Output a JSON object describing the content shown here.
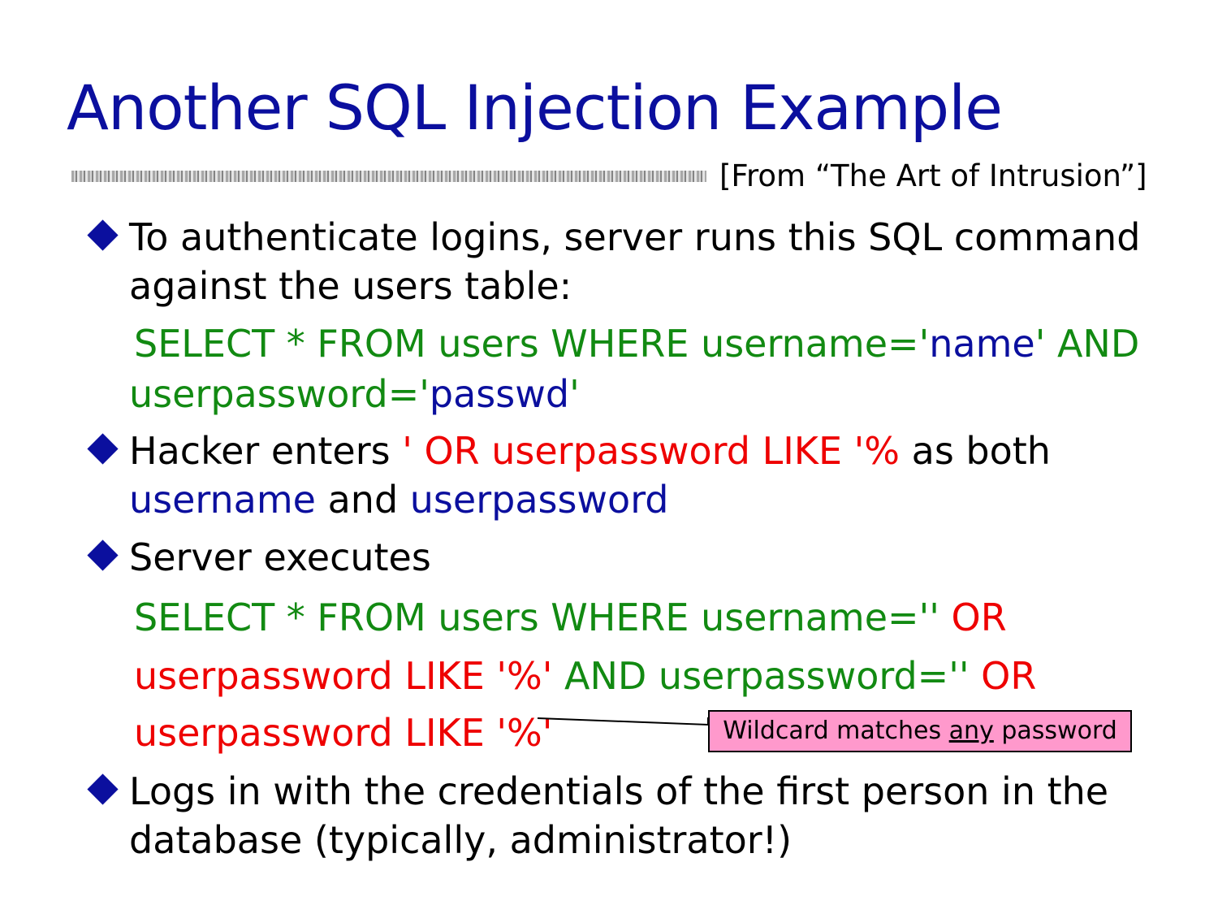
{
  "slide": {
    "title": "Another SQL Injection Example",
    "source": "[From “The Art of Intrusion”]"
  },
  "bullets": {
    "b1_line1": "To authenticate logins, server runs this SQL command",
    "b1_line2": "against the users table:",
    "b2_hacker": "Hacker enters ",
    "b2_input": "' OR userpassword LIKE '%",
    "b2_asboth": " as both",
    "b2_username": "username",
    "b2_and": " and ",
    "b2_userpassword": "userpassword",
    "b3": "Server executes",
    "b4_line1": "Logs in with the credentials of the first person in the",
    "b4_line2": "database (typically, administrator!)"
  },
  "query1": {
    "line1_green": "SELECT * FROM users WHERE username='",
    "line1_blue": "name",
    "line1_green2": "' AND",
    "line2_green": "userpassword='",
    "line2_blue": "passwd",
    "line2_green2": "'"
  },
  "query2": {
    "line1_green": "SELECT * FROM users WHERE username=''",
    "line1_red": " OR",
    "line2_red": "userpassword LIKE '%'",
    "line2_green": " AND userpassword=''",
    "line2_red2": " OR",
    "line3_red": "userpassword LIKE '%'"
  },
  "callout": {
    "before": "Wildcard matches ",
    "emph": "any",
    "after": " password"
  },
  "colors": {
    "title": "#0b0f9e",
    "sql": "#128a12",
    "value": "#0b0f9e",
    "injection": "#ee0000",
    "callout_bg": "#ff99cc"
  }
}
